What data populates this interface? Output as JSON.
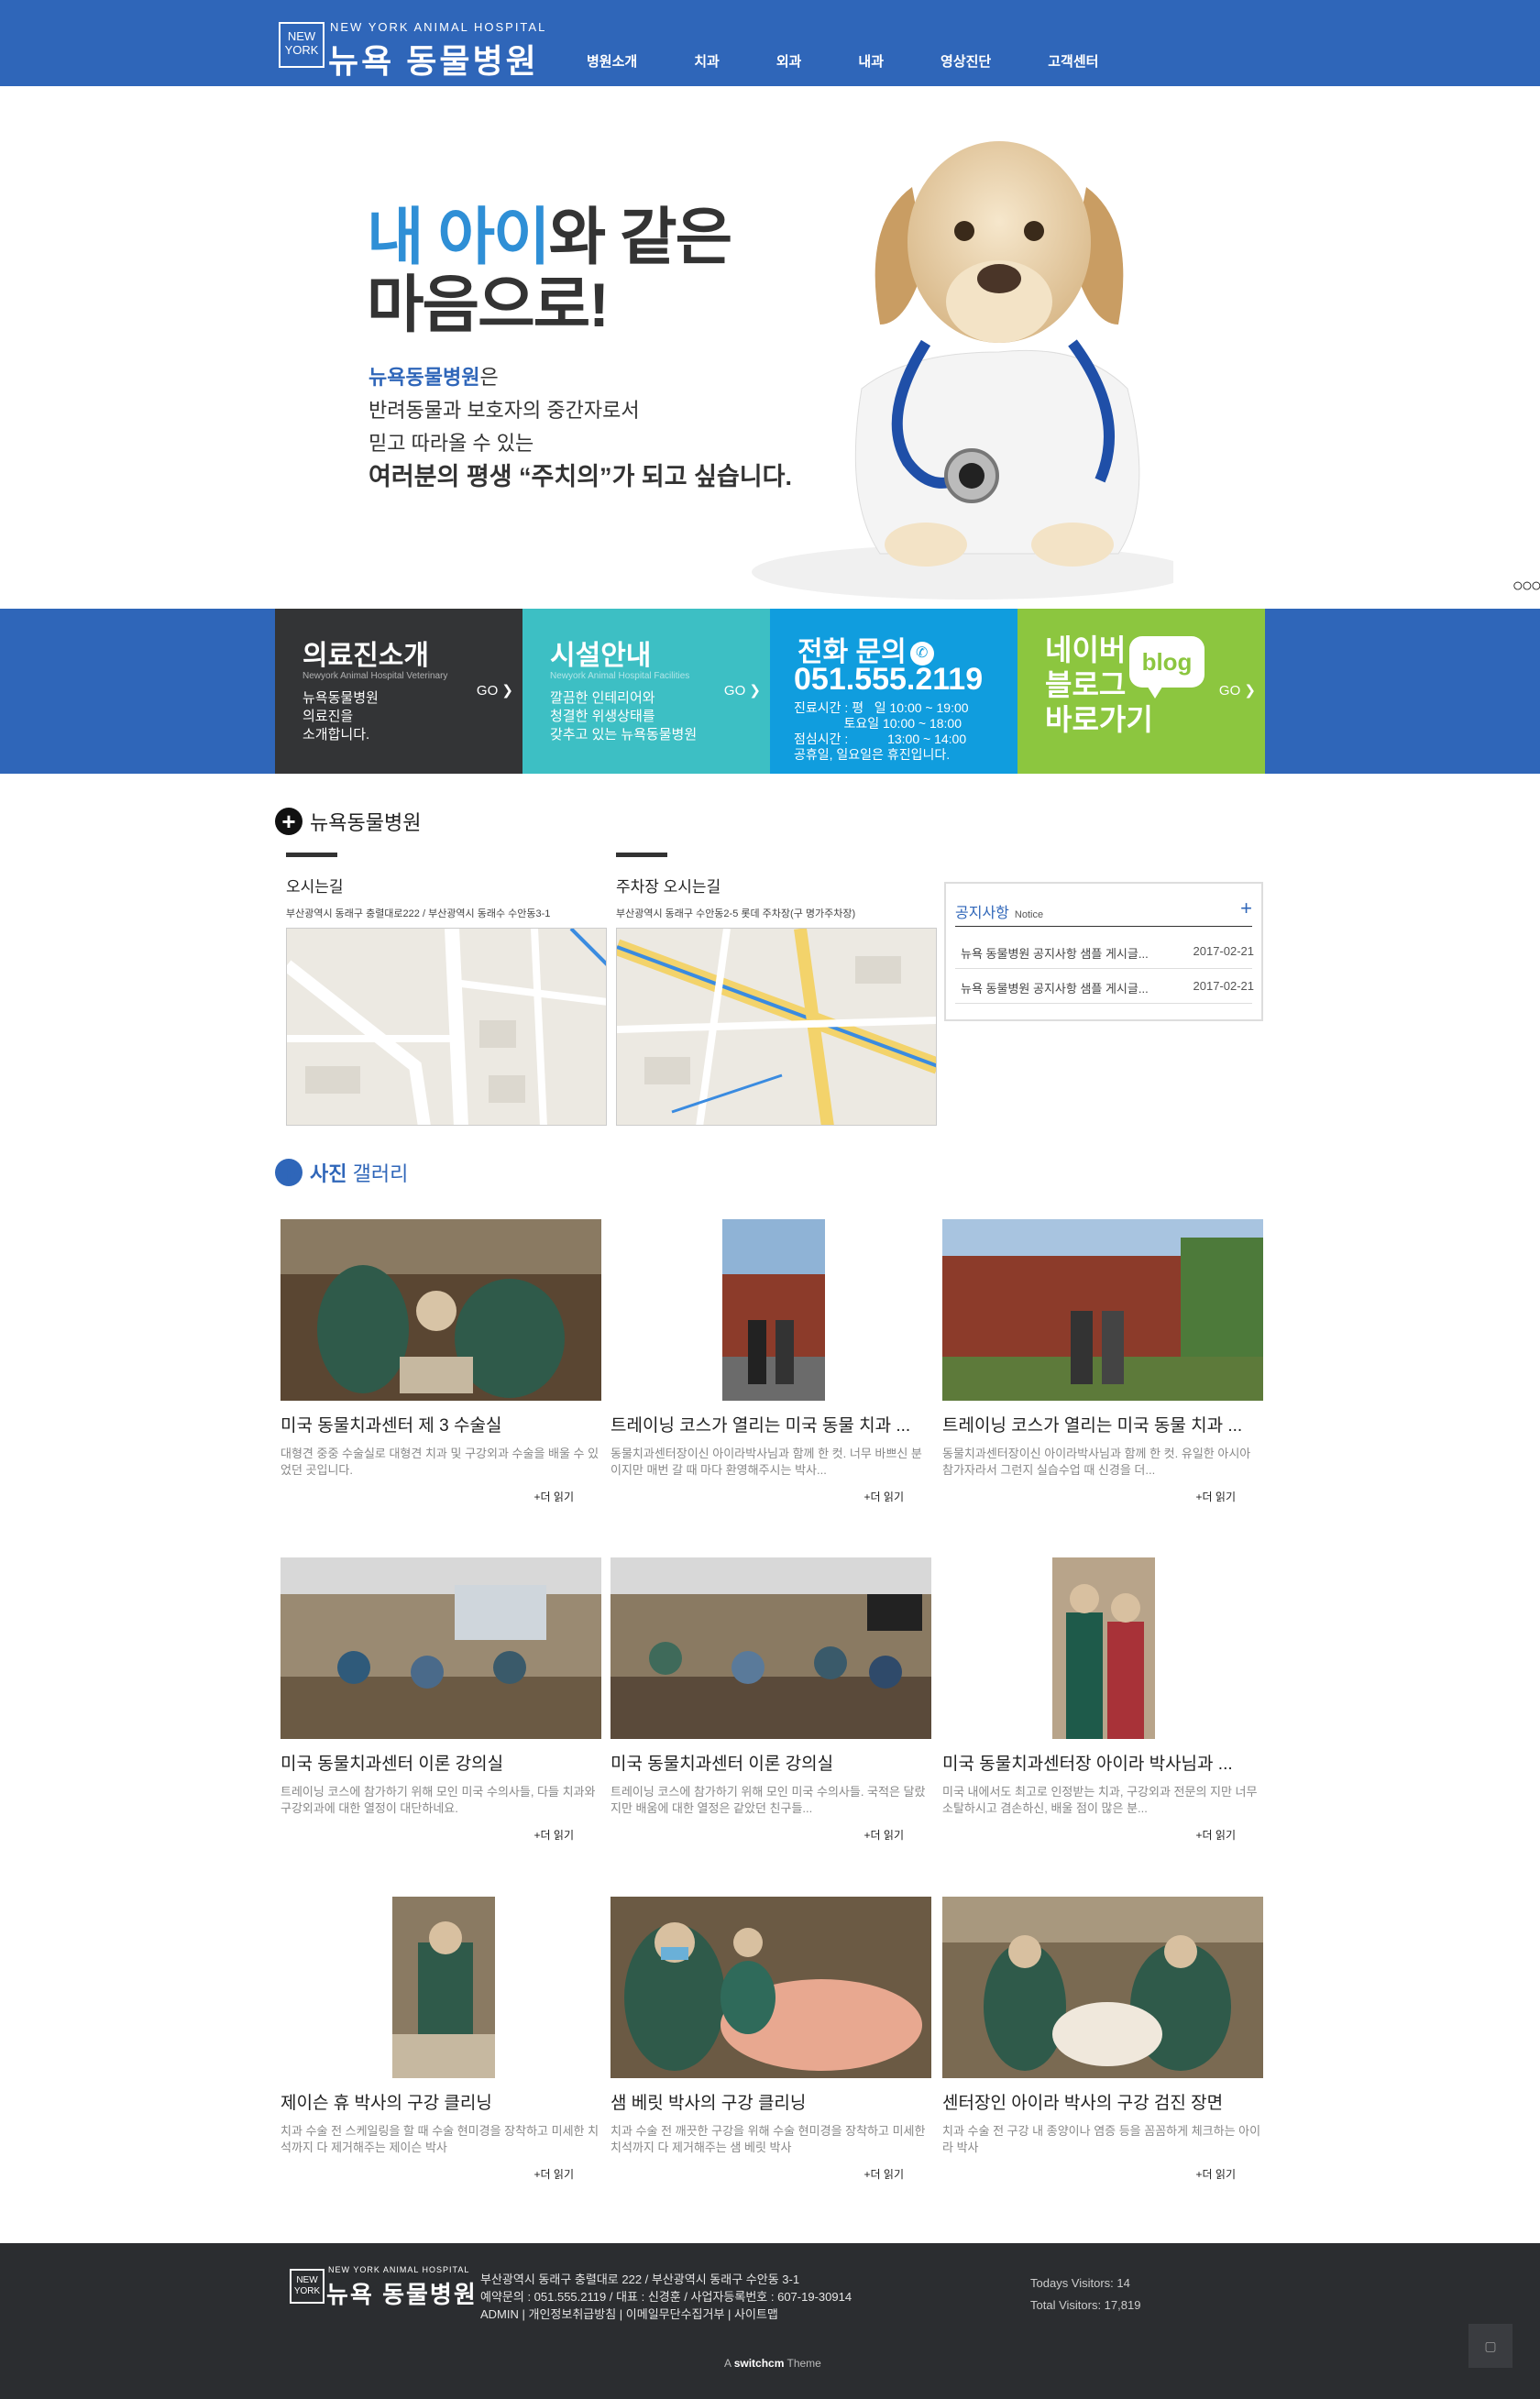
{
  "header": {
    "logo_box": "NEW YORK",
    "logo_sub": "NEW YORK ANIMAL HOSPITAL",
    "logo_main": "뉴욕 동물병원",
    "nav": [
      "병원소개",
      "치과",
      "외과",
      "내과",
      "영상진단",
      "고객센터"
    ]
  },
  "hero": {
    "title_blue": "내 아이",
    "title_rest1": "와 같은",
    "title_line2": "마음으로!",
    "body_blue": "뉴욕동물병원",
    "body_after_blue": "은",
    "body_line2": "반려동물과 보호자의 중간자로서",
    "body_line3": "믿고 따라올 수 있는",
    "body_line4": "여러분의 평생 “주치의”가 되고 싶습니다.",
    "dots": "○○○"
  },
  "promo": {
    "box1": {
      "title": "의료진소개",
      "sub": "Newyork Animal Hospital Veterinary",
      "desc": "뉴욕동물병원\n의료진을\n소개합니다.",
      "go": "GO ❯"
    },
    "box2": {
      "title": "시설안내",
      "sub": "Newyork Animal Hospital Facilities",
      "desc": "깔끔한 인테리어와\n청결한 위생상태를\n갖추고 있는 뉴욕동물병원",
      "go": "GO ❯"
    },
    "box3": {
      "title": "전화 문의",
      "phone": "051.555.2119",
      "hours": "진료시간 : 평   일 10:00 ~ 19:00\n              토요일 10:00 ~ 18:00\n점심시간 :           13:00 ~ 14:00\n공휴일, 일요일은 휴진입니다."
    },
    "box4": {
      "title": "네이버\n블로그\n바로가기",
      "bubble": "blog",
      "go": "GO ❯"
    }
  },
  "location": {
    "heading": "뉴욕동물병원",
    "map1": {
      "title": "오시는길",
      "addr": "부산광역시 동래구 충렬대로222 / 부산광역시 동래수 수안동3-1"
    },
    "map2": {
      "title": "주차장 오시는길",
      "addr": "부산광역시 동래구 수안동2-5 롯데 주차장(구 명가주차장)"
    }
  },
  "notice": {
    "title": "공지사항",
    "sub": "Notice",
    "plus": "+",
    "items": [
      {
        "text": "뉴욕 동물병원 공지사항 샘플 게시글...",
        "date": "2017-02-21"
      },
      {
        "text": "뉴욕 동물병원 공지사항 샘플 게시글...",
        "date": "2017-02-21"
      }
    ]
  },
  "gallery": {
    "heading_bold": "사진",
    "heading_rest": "갤러리",
    "more_label": "+더 읽기",
    "items": [
      {
        "title": "미국 동물치과센터 제 3 수술실",
        "desc": "대형견 중중 수술실로 대형견 치과 및 구강외과 수술을 배울 수 있었던 곳입니다."
      },
      {
        "title": "트레이닝 코스가 열리는 미국 동물 치과 ...",
        "desc": "동물치과센터장이신 아이라박사님과 함께 한 컷. 너무 바쁘신 분이지만 매번 갈 때 마다 환영해주시는 박사..."
      },
      {
        "title": "트레이닝 코스가 열리는 미국 동물 치과 ...",
        "desc": "동물치과센터장이신 아이라박사님과 함께 한 컷. 유일한 아시아 참가자라서 그런지 실습수업 때 신경을 더..."
      },
      {
        "title": "미국 동물치과센터 이론 강의실",
        "desc": "트레이닝 코스에 참가하기 위해 모인 미국 수의사들, 다들 치과와 구강외과에 대한 열정이 대단하네요."
      },
      {
        "title": "미국 동물치과센터 이론 강의실",
        "desc": "트레이닝 코스에 참가하기 위해 모인 미국 수의사들. 국적은 달랐지만 배움에 대한 열정은 같았던 친구들..."
      },
      {
        "title": "미국 동물치과센터장 아이라 박사님과 ...",
        "desc": "미국 내에서도 최고로 인정받는 치과, 구강외과 전문의 지만 너무 소탈하시고 겸손하신, 배울 점이 많은 분..."
      },
      {
        "title": "제이슨 휴 박사의 구강 클리닝",
        "desc": "치과 수술 전 스케일링을 할 때 수술 현미경을 장착하고 미세한 치석까지 다 제거해주는 제이슨 박사"
      },
      {
        "title": "샘 베릿 박사의 구강 클리닝",
        "desc": "치과 수술 전 깨끗한 구강을 위해 수술 현미경을 장착하고 미세한 치석까지 다 제거해주는 샘 베릿 박사"
      },
      {
        "title": "센터장인 아이라 박사의 구강 검진 장면",
        "desc": "치과 수술 전 구강 내 종양이나 염증 등을 꼼꼼하게 체크하는 아이라 박사"
      }
    ]
  },
  "footer": {
    "logo_box": "NEW YORK",
    "logo_sub": "NEW YORK ANIMAL HOSPITAL",
    "logo_main": "뉴욕 동물병원",
    "addr": "부산광역시 동래구 충렬대로 222 / 부산광역시 동래구 수안동 3-1",
    "contact": "예약문의 : 051.555.2119 / 대표 : 신경훈 / 사업자등록번호 : 607-19-30914",
    "links": [
      "ADMIN",
      "개인정보취급방침",
      "이메일무단수집거부",
      "사이트맵"
    ],
    "visitors_today": "Todays Visitors: 14",
    "visitors_total": "Total Visitors: 17,819",
    "credit_a": "A",
    "credit_b": "switchcm",
    "credit_c": "Theme",
    "top_btn": "▢"
  },
  "colors": {
    "brand": "#2f66b9",
    "dark": "#333436",
    "teal": "#3dbfc4",
    "sky": "#109dde",
    "green": "#8cc63f",
    "footer": "#2b2d30"
  }
}
